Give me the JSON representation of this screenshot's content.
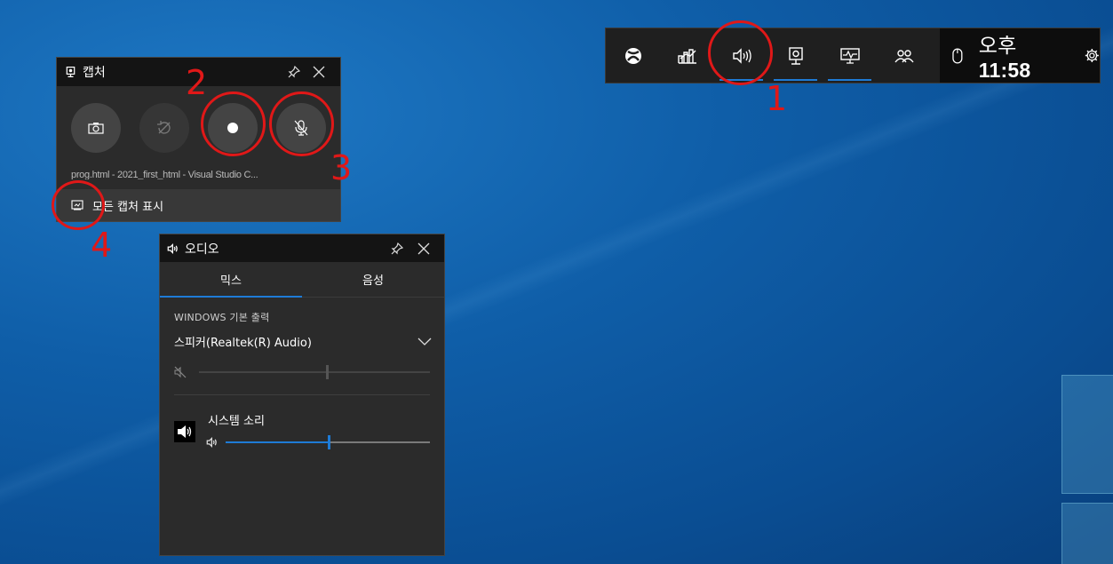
{
  "gamebar": {
    "buttons": [
      {
        "icon": "xbox-icon"
      },
      {
        "icon": "performance-icon"
      },
      {
        "icon": "audio-icon",
        "active": true
      },
      {
        "icon": "capture-icon",
        "active": true
      },
      {
        "icon": "resources-icon",
        "active": true
      },
      {
        "icon": "social-icon"
      }
    ],
    "clock_ampm": "오후",
    "clock_time": "11:58"
  },
  "capture": {
    "title": "캡처",
    "source_window": "prog.html - 2021_first_html - Visual Studio C...",
    "footer_label": "모든 캡처 표시"
  },
  "audio": {
    "title": "오디오",
    "tabs": [
      "믹스",
      "음성"
    ],
    "active_tab": 0,
    "section_label": "WINDOWS 기본 출력",
    "device_name": "스피커(Realtek(R) Audio)",
    "device_volume": 0.55,
    "device_muted": true,
    "apps": [
      {
        "name": "시스템 소리",
        "volume": 0.5
      }
    ]
  },
  "annotations": [
    "1",
    "2",
    "3",
    "4"
  ],
  "colors": {
    "accent": "#1e7bd6",
    "annotation": "#e01818"
  }
}
